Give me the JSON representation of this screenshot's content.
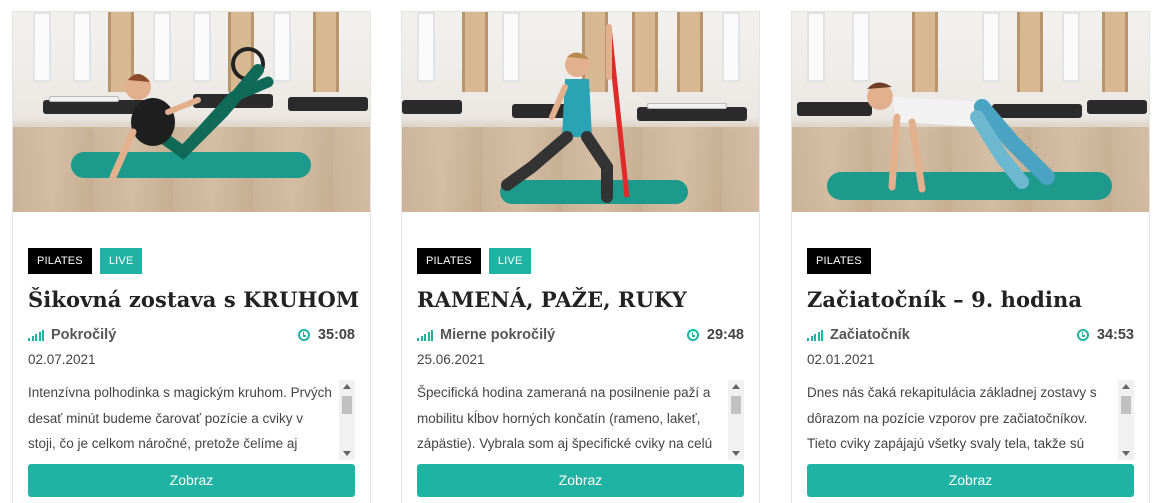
{
  "cards": [
    {
      "tags": [
        "PILATES",
        "LIVE"
      ],
      "title": "Šikovná zostava s KRUHOM",
      "level": "Pokročilý",
      "duration": "35:08",
      "date": "02.07.2021",
      "description": "Intenzívna polhodinka s magickým kruhom. Prvých desať minút budeme čarovať pozície a cviky v stoji, čo je celkom náročné, pretože čelíme aj gravitačnej",
      "button_label": "Zobraz"
    },
    {
      "tags": [
        "PILATES",
        "LIVE"
      ],
      "title": "RAMENÁ, PAŽE, RUKY",
      "level": "Mierne pokročilý",
      "duration": "29:48",
      "date": "25.06.2021",
      "description": "Špecifická hodina zameraná na posilnenie paží a mobilitu kĺbov horných končatín (rameno, lakeť, zápästie). Vybrala som aj špecifické cviky na celú",
      "button_label": "Zobraz"
    },
    {
      "tags": [
        "PILATES"
      ],
      "title": "Začiatočník – 9. hodina",
      "level": "Začiatočník",
      "duration": "34:53",
      "date": "02.01.2021",
      "description": "Dnes nás čaká rekapitulácia základnej zostavy s dôrazom na pozície vzporov pre začiatočníkov. Tieto cviky zapájajú všetky svaly tela, takže sú veľmi",
      "button_label": "Zobraz"
    }
  ],
  "colors": {
    "accent": "#1fb3a3",
    "tag_dark": "#000000",
    "title": "#222222"
  },
  "icons": {
    "level": "signal-bars-icon",
    "duration": "clock-icon"
  }
}
